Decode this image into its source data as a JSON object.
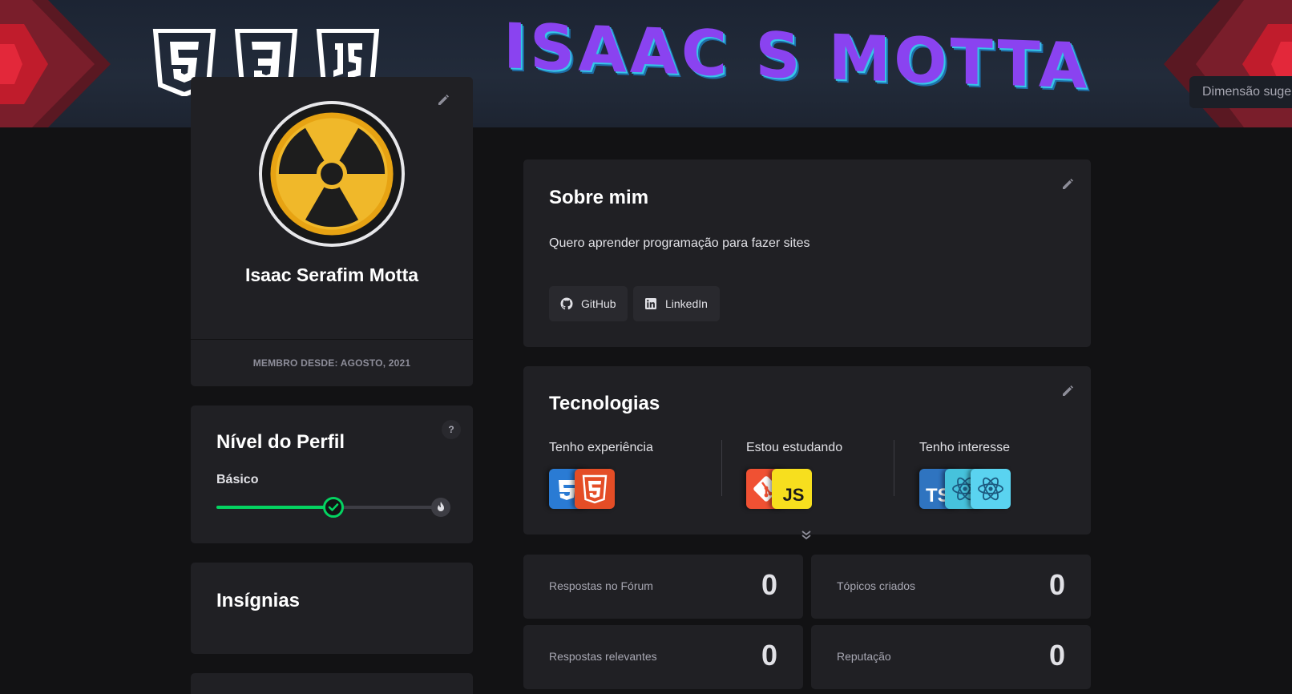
{
  "banner": {
    "title": "ISAAC S MOTTA",
    "logos": [
      "html5-logo",
      "css3-logo",
      "js-logo"
    ],
    "dimension_chip": "Dimensão suge"
  },
  "profile": {
    "name": "Isaac Serafim Motta",
    "member_since": "MEMBRO DESDE: AGOSTO, 2021",
    "avatar": "radioactive-symbol"
  },
  "level": {
    "title": "Nível do Perfil",
    "help": "?",
    "current": "Básico",
    "progress": 0.52
  },
  "badges": {
    "title": "Insígnias"
  },
  "about": {
    "title": "Sobre mim",
    "text": "Quero aprender programação para fazer sites",
    "links": [
      {
        "label": "GitHub",
        "icon": "github-icon"
      },
      {
        "label": "LinkedIn",
        "icon": "linkedin-icon"
      }
    ]
  },
  "technologies": {
    "title": "Tecnologias",
    "columns": [
      {
        "title": "Tenho experiência",
        "icons": [
          "css3",
          "html5"
        ]
      },
      {
        "title": "Estou estudando",
        "icons": [
          "git",
          "javascript"
        ]
      },
      {
        "title": "Tenho interesse",
        "icons": [
          "typescript",
          "react",
          "react"
        ]
      }
    ]
  },
  "stats": [
    {
      "label": "Respostas no Fórum",
      "value": "0"
    },
    {
      "label": "Tópicos criados",
      "value": "0"
    },
    {
      "label": "Respostas relevantes",
      "value": "0"
    },
    {
      "label": "Reputação",
      "value": "0"
    }
  ],
  "colors": {
    "background": "#121214",
    "card": "#202024",
    "progress": "#04d361",
    "banner_title": "#8a43f0",
    "banner_title_shadow": "#35c6e8"
  }
}
